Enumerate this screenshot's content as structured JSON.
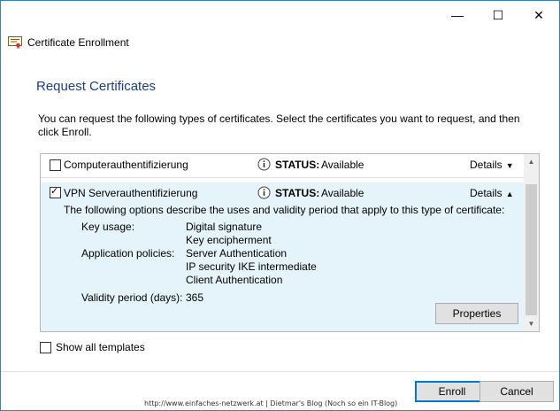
{
  "window": {
    "controls": {
      "minimize": "—",
      "maximize": "☐",
      "close": "✕"
    },
    "app_title": "Certificate Enrollment",
    "app_icon": "certificate-icon"
  },
  "page": {
    "heading": "Request Certificates",
    "intro": "You can request the following types of certificates. Select the certificates you want to request, and then click Enroll."
  },
  "certificates": [
    {
      "name": "Computerauthentifizierung",
      "checked": false,
      "status_label": "STATUS:",
      "status_value": "Available",
      "details_label": "Details",
      "expanded": false
    },
    {
      "name": "VPN Serverauthentifizierung",
      "checked": true,
      "status_label": "STATUS:",
      "status_value": "Available",
      "details_label": "Details",
      "expanded": true,
      "description": "The following options describe the uses and validity period that apply to this type of certificate:",
      "key_usage_label": "Key usage:",
      "key_usage": [
        "Digital signature",
        "Key encipherment"
      ],
      "app_policies_label": "Application policies:",
      "app_policies": [
        "Server Authentication",
        "IP security IKE intermediate",
        "Client Authentication"
      ],
      "validity_label": "Validity period (days):",
      "validity_value": "365",
      "properties_label": "Properties"
    }
  ],
  "show_all_templates": {
    "label": "Show all templates",
    "checked": false
  },
  "footer": {
    "watermark": "http://www.einfaches-netzwerk.at | Dietmar's Blog (Noch so ein IT-Blog)",
    "enroll_label": "Enroll",
    "cancel_label": "Cancel"
  },
  "colors": {
    "heading": "#1c3d88",
    "selected_row": "#e5f3fb",
    "focus_border": "#0078d7"
  }
}
